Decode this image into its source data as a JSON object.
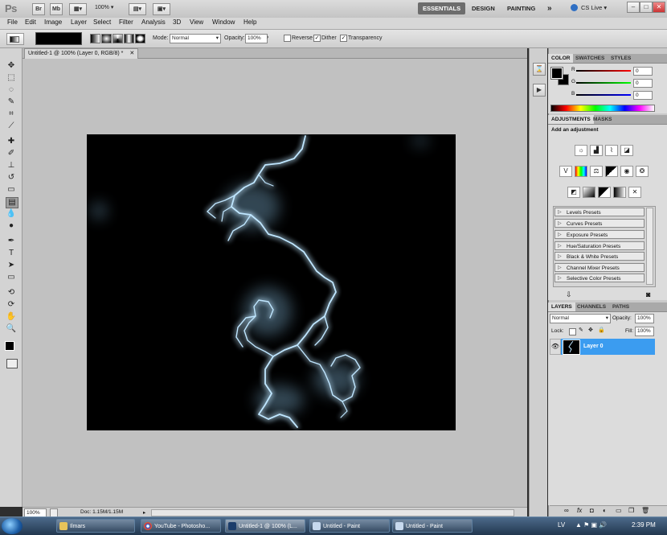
{
  "app": {
    "logo": "Ps",
    "bridge": "Br",
    "minibridge": "Mb",
    "zoom": "100%",
    "workspaces": [
      "ESSENTIALS",
      "DESIGN",
      "PAINTING"
    ],
    "more": "»",
    "cslive": "CS Live",
    "window_buttons": [
      "–",
      "□",
      "✕"
    ]
  },
  "menu": [
    "File",
    "Edit",
    "Image",
    "Layer",
    "Select",
    "Filter",
    "Analysis",
    "3D",
    "View",
    "Window",
    "Help"
  ],
  "options": {
    "mode_label": "Mode:",
    "mode_value": "Normal",
    "opacity_label": "Opacity:",
    "opacity_value": "100%",
    "reverse": "Reverse",
    "dither": "Dither",
    "transparency": "Transparency"
  },
  "document": {
    "tab_title": "Untitled-1 @ 100% (Layer 0, RGB/8) *",
    "tab_close": "✕"
  },
  "status": {
    "zoom": "100%",
    "doc": "Doc: 1.15M/1.15M"
  },
  "color_panel": {
    "tabs": [
      "COLOR",
      "SWATCHES",
      "STYLES"
    ],
    "channels": [
      {
        "label": "R",
        "value": "0",
        "color": "#cc0000"
      },
      {
        "label": "G",
        "value": "0",
        "color": "#00aa00"
      },
      {
        "label": "B",
        "value": "0",
        "color": "#0000cc"
      }
    ]
  },
  "adjustments_panel": {
    "tabs": [
      "ADJUSTMENTS",
      "MASKS"
    ],
    "heading": "Add an adjustment",
    "presets": [
      "Levels Presets",
      "Curves Presets",
      "Exposure Presets",
      "Hue/Saturation Presets",
      "Black & White Presets",
      "Channel Mixer Presets",
      "Selective Color Presets"
    ]
  },
  "layers_panel": {
    "tabs": [
      "LAYERS",
      "CHANNELS",
      "PATHS"
    ],
    "blend_mode": "Normal",
    "opacity_label": "Opacity:",
    "opacity_value": "100%",
    "lock_label": "Lock:",
    "fill_label": "Fill:",
    "fill_value": "100%",
    "layers": [
      {
        "name": "Layer 0",
        "selected": true
      }
    ]
  },
  "taskbar": {
    "tasks": [
      "Ilmars",
      "YouTube - Photosho...",
      "Untitled-1 @ 100% (L...",
      "Untitled - Paint",
      "Untitled - Paint"
    ],
    "language": "LV",
    "clock": "2:39 PM"
  },
  "colors": {
    "accent": "#3b9cf0",
    "lightning": "#bfe6ff"
  }
}
